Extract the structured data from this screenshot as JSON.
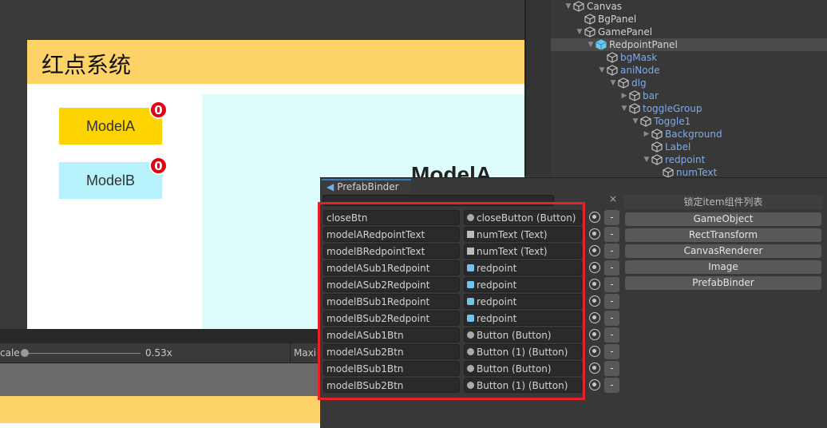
{
  "game": {
    "title": "红点系统",
    "buttons": [
      {
        "label": "ModelA",
        "badge": "0",
        "color": "#fed400"
      },
      {
        "label": "ModelB",
        "badge": "0",
        "color": "#b5f2fb"
      }
    ],
    "panel_title": "ModelA",
    "toolbar": {
      "scale_label": "cale",
      "scale_value": "0.53x",
      "maximize_label": "Maxi"
    }
  },
  "hierarchy": {
    "items": [
      {
        "label": "Canvas",
        "depth": 0,
        "arrow": "down",
        "blue": false
      },
      {
        "label": "BgPanel",
        "depth": 1,
        "arrow": "",
        "blue": false
      },
      {
        "label": "GamePanel",
        "depth": 1,
        "arrow": "down",
        "blue": false
      },
      {
        "label": "RedpointPanel",
        "depth": 2,
        "arrow": "down",
        "blue": false,
        "selected": true,
        "prefab": true
      },
      {
        "label": "bgMask",
        "depth": 3,
        "arrow": "",
        "blue": true
      },
      {
        "label": "aniNode",
        "depth": 3,
        "arrow": "down",
        "blue": true
      },
      {
        "label": "dlg",
        "depth": 4,
        "arrow": "down",
        "blue": true
      },
      {
        "label": "bar",
        "depth": 5,
        "arrow": "right",
        "blue": true
      },
      {
        "label": "toggleGroup",
        "depth": 5,
        "arrow": "down",
        "blue": true
      },
      {
        "label": "Toggle1",
        "depth": 6,
        "arrow": "down",
        "blue": true
      },
      {
        "label": "Background",
        "depth": 7,
        "arrow": "right",
        "blue": true
      },
      {
        "label": "Label",
        "depth": 7,
        "arrow": "",
        "blue": true
      },
      {
        "label": "redpoint",
        "depth": 7,
        "arrow": "down",
        "blue": true
      },
      {
        "label": "numText",
        "depth": 8,
        "arrow": "",
        "blue": true
      }
    ]
  },
  "binder": {
    "tab": "PrefabBinder",
    "search_value": "",
    "clear": "×",
    "lock_title": "锁定item组件列表",
    "rows": [
      {
        "name": "closeBtn",
        "value": "closeButton (Button)",
        "icon": "button"
      },
      {
        "name": "modelARedpointText",
        "value": "numText (Text)",
        "icon": "text"
      },
      {
        "name": "modelBRedpointText",
        "value": "numText (Text)",
        "icon": "text"
      },
      {
        "name": "modelASub1Redpoint",
        "value": "redpoint",
        "icon": "prefab"
      },
      {
        "name": "modelASub2Redpoint",
        "value": "redpoint",
        "icon": "prefab"
      },
      {
        "name": "modelBSub1Redpoint",
        "value": "redpoint",
        "icon": "prefab"
      },
      {
        "name": "modelBSub2Redpoint",
        "value": "redpoint",
        "icon": "prefab"
      },
      {
        "name": "modelASub1Btn",
        "value": "Button (Button)",
        "icon": "button"
      },
      {
        "name": "modelASub2Btn",
        "value": "Button (1) (Button)",
        "icon": "button"
      },
      {
        "name": "modelBSub1Btn",
        "value": "Button (Button)",
        "icon": "button"
      },
      {
        "name": "modelBSub2Btn",
        "value": "Button (1) (Button)",
        "icon": "button"
      }
    ],
    "minus_label": "-",
    "components": [
      "GameObject",
      "RectTransform",
      "CanvasRenderer",
      "Image",
      "PrefabBinder"
    ],
    "highlight_color": "#e8202a"
  }
}
